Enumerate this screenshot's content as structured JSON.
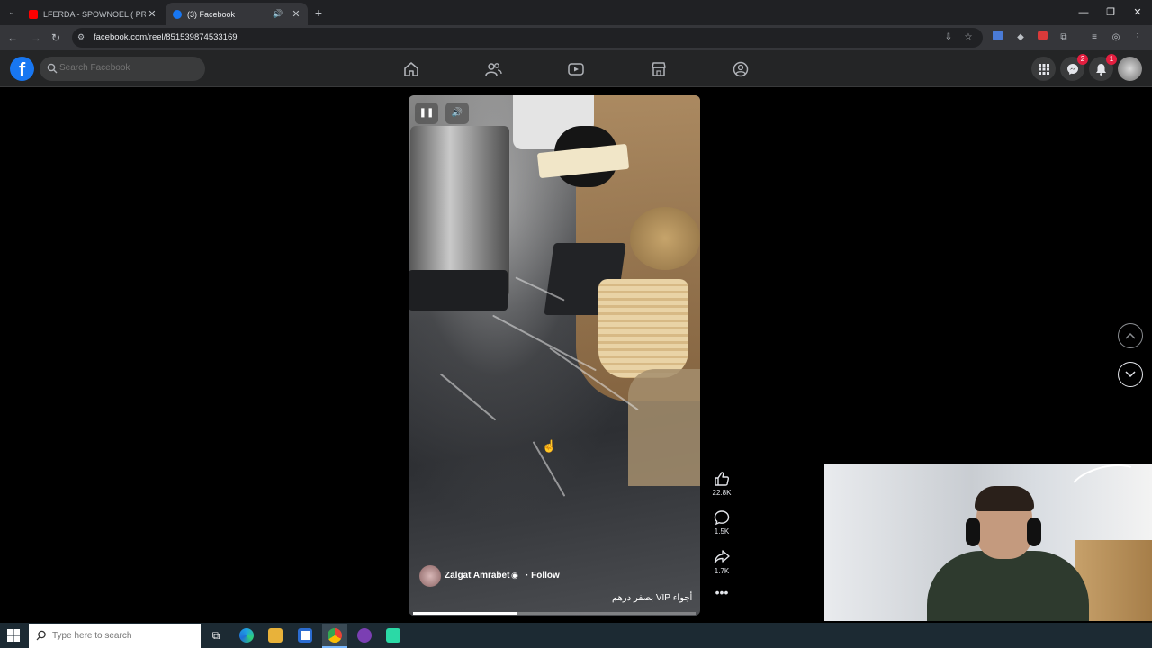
{
  "browser": {
    "tabs": [
      {
        "title": "LFERDA - SPOWNOEL ( PROD B",
        "active": false,
        "favicon_color": "#ff0000"
      },
      {
        "title": "(3) Facebook",
        "active": true,
        "favicon_color": "#1877f2"
      }
    ],
    "url": "facebook.com/reel/851539874533169"
  },
  "facebook": {
    "search_placeholder": "Search Facebook",
    "messenger_badge": "2",
    "notifications_badge": "1"
  },
  "reel": {
    "author": "Zalgat Amrabet",
    "follow_label": "· Follow",
    "caption": "أجواء VIP بصفر درهم",
    "progress_fraction": 0.37,
    "likes": "22.8K",
    "comments": "1.5K",
    "shares": "1.7K"
  },
  "taskbar": {
    "search_placeholder": "Type here to search"
  },
  "colors": {
    "fb_blue": "#1877f2",
    "badge_red": "#e41e3f",
    "header_bg": "#242526"
  }
}
